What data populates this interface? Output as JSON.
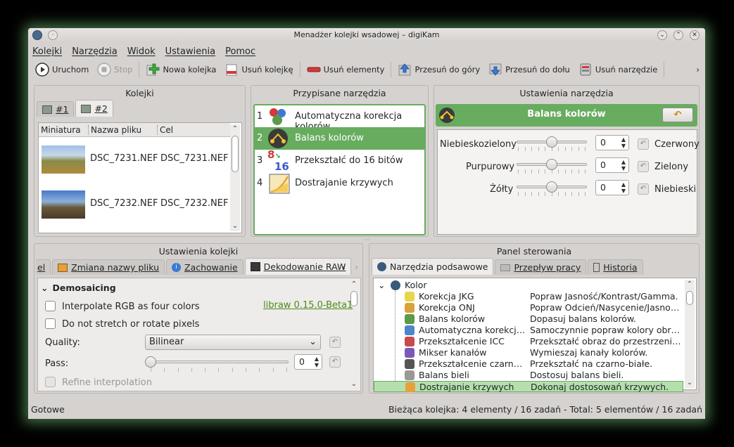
{
  "window": {
    "title": "Menadżer kolejki wsadowej – digiKam"
  },
  "menu": [
    "Kolejki",
    "Narzędzia",
    "Widok",
    "Ustawienia",
    "Pomoc"
  ],
  "toolbar": {
    "run": "Uruchom",
    "stop": "Stop",
    "new_queue": "Nowa kolejka",
    "remove_queue": "Usuń kolejkę",
    "remove_items": "Usuń elementy",
    "move_up": "Przesuń do góry",
    "move_down": "Przesuń do dołu",
    "remove_tool": "Usuń narzędzie",
    "overflow": "›"
  },
  "queues_panel": {
    "title": "Kolejki",
    "tabs": [
      "#1",
      "#2"
    ],
    "columns": [
      "Miniatura",
      "Nazwa pliku",
      "Cel"
    ],
    "rows": [
      {
        "file": "DSC_7231.NEF",
        "target": "DSC_7231.NEF"
      },
      {
        "file": "DSC_7232.NEF",
        "target": "DSC_7232.NEF"
      }
    ]
  },
  "assigned_panel": {
    "title": "Przypisane narzędzia",
    "tools": [
      {
        "num": "1",
        "name": "Automatyczna korekcja kolorów"
      },
      {
        "num": "2",
        "name": "Balans kolorów"
      },
      {
        "num": "3",
        "name": "Przekształć do 16 bitów"
      },
      {
        "num": "4",
        "name": "Dostrajanie krzywych"
      }
    ]
  },
  "tool_settings": {
    "title": "Ustawienia narzędzia",
    "tool_name": "Balans kolorów",
    "sliders": [
      {
        "left": "Niebieskozielony",
        "right": "Czerwony",
        "value": "0"
      },
      {
        "left": "Purpurowy",
        "right": "Zielony",
        "value": "0"
      },
      {
        "left": "Żółty",
        "right": "Niebieski",
        "value": "0"
      }
    ]
  },
  "queue_settings": {
    "title": "Ustawienia kolejki",
    "tabs": [
      "el",
      "Zmiana nazwy pliku",
      "Zachowanie",
      "Dekodowanie RAW"
    ],
    "section": "Demosaicing",
    "opt1": "Interpolate RGB as four colors",
    "opt2": "Do not stretch or rotate pixels",
    "libraw": "libraw 0.15.0-Beta1",
    "quality_label": "Quality:",
    "quality_value": "Bilinear",
    "pass_label": "Pass:",
    "pass_value": "0",
    "refine": "Refine interpolation"
  },
  "control_panel": {
    "title": "Panel sterowania",
    "tabs": [
      "Narzędzia podsawowe",
      "Przepływ pracy",
      "Historia"
    ],
    "root": "Kolor",
    "items": [
      {
        "name": "Korekcja JKG",
        "desc": "Popraw Jasność/Kontrast/Gamma.",
        "color": "#e8d64a"
      },
      {
        "name": "Korekcja ONJ",
        "desc": "Popraw Odcień/Nasycenie/Jasność.",
        "color": "#d9a23a"
      },
      {
        "name": "Balans kolorów",
        "desc": "Dopasuj balans kolorów.",
        "color": "#5a9a48"
      },
      {
        "name": "Automatyczna korekcja ...",
        "desc": "Samoczynnie popraw kolory obrazu.",
        "color": "#4a86c8"
      },
      {
        "name": "Przekształcenie ICC",
        "desc": "Przekształć obraz do przestrzeni k...",
        "color": "#c84a4a"
      },
      {
        "name": "Mikser kanałów",
        "desc": "Wymieszaj kanały kolorów.",
        "color": "#7a5ab8"
      },
      {
        "name": "Przekształcenie czarno-...",
        "desc": "Przekształć na czarno-białe.",
        "color": "#555555"
      },
      {
        "name": "Balans bieli",
        "desc": "Dostosuj balans bieli.",
        "color": "#9a9895"
      },
      {
        "name": "Dostrajanie krzywych",
        "desc": "Dokonaj dostosowań krzywych.",
        "color": "#e8a03a"
      }
    ]
  },
  "status": {
    "left": "Gotowe",
    "right": "Bieżąca kolejka: 4 elementy / 16 zadań - Total: 5 elementów / 16 zadań"
  }
}
